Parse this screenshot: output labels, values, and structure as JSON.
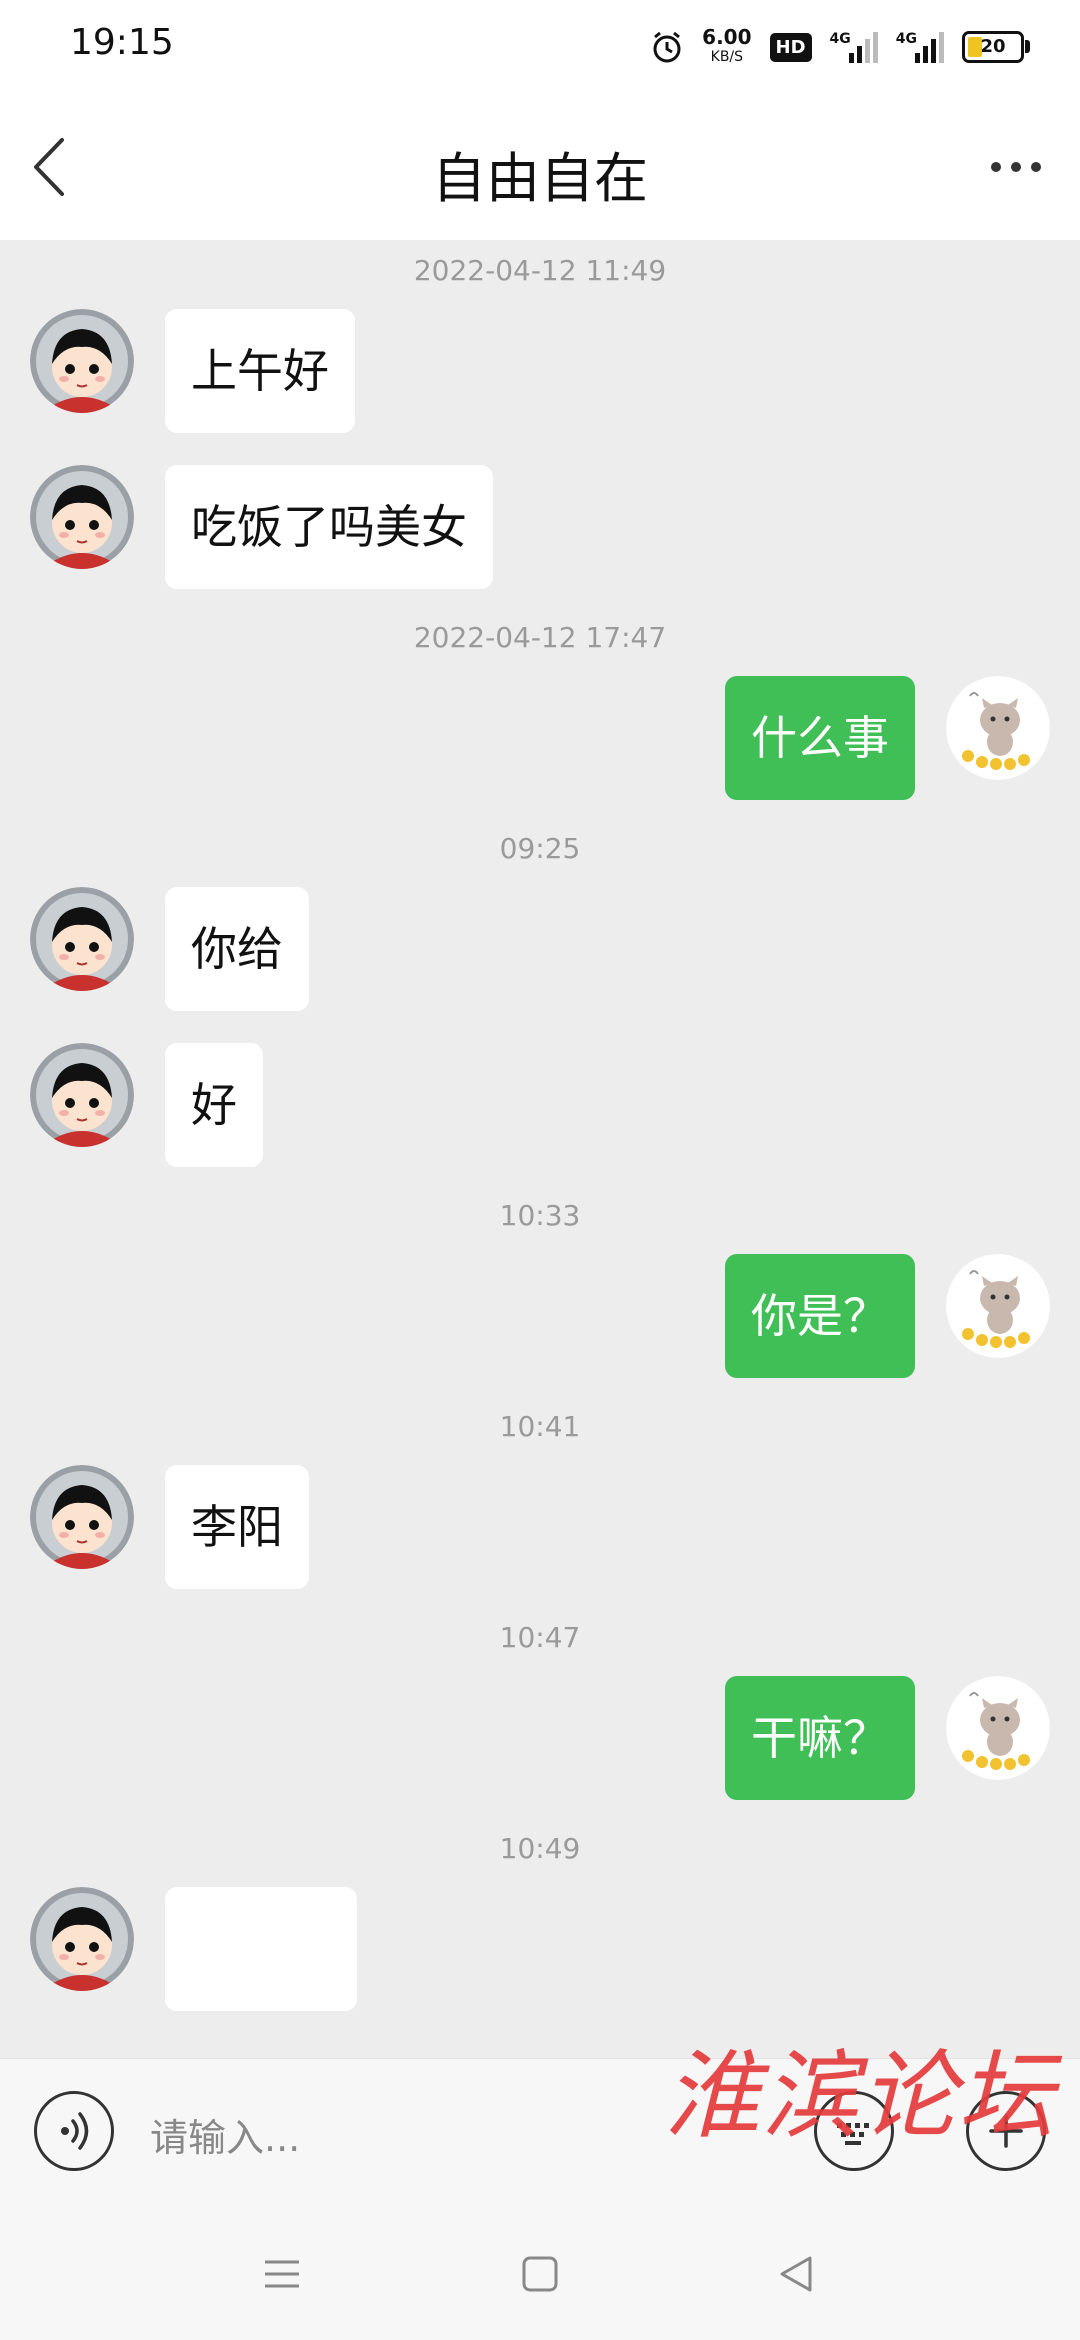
{
  "status_bar": {
    "time": "19:15",
    "speed_value": "6.00",
    "speed_unit": "KB/S",
    "hd_badge": "HD",
    "net_1": "4G",
    "net_2": "4G",
    "battery": "20",
    "battery_color": "#f0c420"
  },
  "header": {
    "title": "自由自在",
    "back_icon": "chevron-left-icon",
    "more_icon": "more-dots-icon"
  },
  "messages": [
    {
      "type": "timestamp",
      "text": "2022-04-12 11:49"
    },
    {
      "type": "in",
      "text": "上午好"
    },
    {
      "type": "in",
      "text": "吃饭了吗美女"
    },
    {
      "type": "timestamp",
      "text": "2022-04-12 17:47"
    },
    {
      "type": "out",
      "text": "什么事"
    },
    {
      "type": "timestamp",
      "text": "09:25"
    },
    {
      "type": "in",
      "text": "你给"
    },
    {
      "type": "in",
      "text": "好"
    },
    {
      "type": "timestamp",
      "text": "10:33"
    },
    {
      "type": "out",
      "text": "你是？"
    },
    {
      "type": "timestamp",
      "text": "10:41"
    },
    {
      "type": "in",
      "text": "李阳"
    },
    {
      "type": "timestamp",
      "text": "10:47"
    },
    {
      "type": "out",
      "text": "干嘛？"
    },
    {
      "type": "timestamp",
      "text": "10:49"
    }
  ],
  "input_bar": {
    "placeholder": "请输入...",
    "voice_icon": "voice-icon",
    "keyboard_icon": "keyboard-icon",
    "add_icon": "plus-icon",
    "watermark": "淮滨论坛"
  },
  "colors": {
    "out_bubble": "#3fbf56",
    "in_bubble": "#ffffff",
    "chat_bg": "#ededed"
  }
}
